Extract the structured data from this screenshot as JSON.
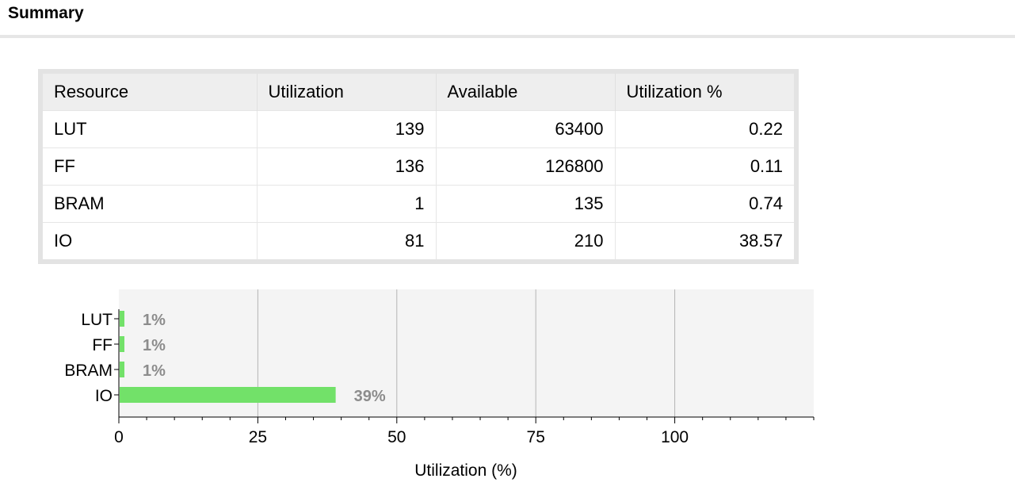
{
  "header": {
    "title": "Summary"
  },
  "table": {
    "columns": [
      "Resource",
      "Utilization",
      "Available",
      "Utilization %"
    ],
    "rows": [
      [
        "LUT",
        "139",
        "63400",
        "0.22"
      ],
      [
        "FF",
        "136",
        "126800",
        "0.11"
      ],
      [
        "BRAM",
        "1",
        "135",
        "0.74"
      ],
      [
        "IO",
        "81",
        "210",
        "38.57"
      ]
    ]
  },
  "chart_data": {
    "type": "bar",
    "orientation": "horizontal",
    "categories": [
      "LUT",
      "FF",
      "BRAM",
      "IO"
    ],
    "values": [
      1,
      1,
      1,
      39
    ],
    "data_labels": [
      "1%",
      "1%",
      "1%",
      "39%"
    ],
    "xlabel": "Utilization (%)",
    "ylabel": "",
    "xlim": [
      0,
      125
    ],
    "xticks": [
      0,
      25,
      50,
      75,
      100
    ],
    "grid": true,
    "bar_color": "#72e169",
    "plot_bg": "#f4f4f4",
    "label_color": "#8c8c8c"
  }
}
